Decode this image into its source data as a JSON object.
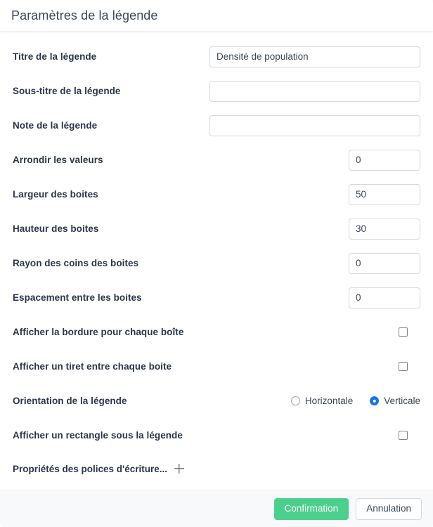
{
  "dialog": {
    "title": "Paramètres de la légende",
    "colors": {
      "confirm_button": "#4bcf8d",
      "radio_selected": "#1a73e8",
      "label_text": "#2b3648",
      "footer_background": "#f8f9fb"
    }
  },
  "fields": {
    "title": {
      "label": "Titre de la légende",
      "value": "Densité de population",
      "placeholder": ""
    },
    "subtitle": {
      "label": "Sous-titre de la légende",
      "value": "",
      "placeholder": ""
    },
    "note": {
      "label": "Note de la légende",
      "value": "",
      "placeholder": ""
    },
    "round_values": {
      "label": "Arrondir les valeurs",
      "value": "0"
    },
    "box_width": {
      "label": "Largeur des boites",
      "value": "50"
    },
    "box_height": {
      "label": "Hauteur des boites",
      "value": "30"
    },
    "box_corner_radius": {
      "label": "Rayon des coins des boites",
      "value": "0"
    },
    "box_spacing": {
      "label": "Espacement entre les boites",
      "value": "0"
    },
    "show_border": {
      "label": "Afficher la bordure pour chaque boîte",
      "checked": false
    },
    "show_dash": {
      "label": "Afficher un tiret entre chaque boite",
      "checked": false
    },
    "orientation": {
      "label": "Orientation de la légende",
      "options": [
        {
          "label": "Horizontale",
          "selected": false
        },
        {
          "label": "Verticale",
          "selected": true
        }
      ]
    },
    "show_rectangle": {
      "label": "Afficher un rectangle sous la légende",
      "checked": false
    },
    "font_properties": {
      "label": "Propriétés des polices d'écriture...",
      "icon": "plus-icon"
    }
  },
  "footer": {
    "confirm_label": "Confirmation",
    "cancel_label": "Annulation"
  }
}
